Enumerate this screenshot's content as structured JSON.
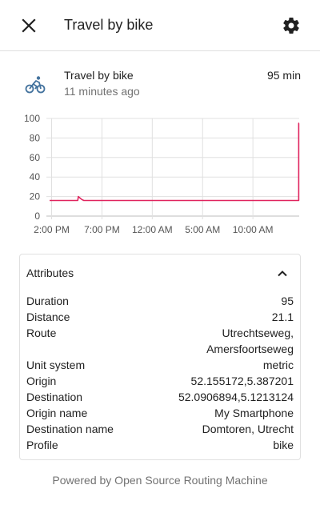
{
  "header": {
    "title": "Travel by bike",
    "close_icon": "close-icon",
    "settings_icon": "gear-icon"
  },
  "entity": {
    "name": "Travel by bike",
    "last_changed": "11 minutes ago",
    "value": "95 min",
    "icon": "bicycle-icon",
    "icon_color": "#44739e"
  },
  "chart_data": {
    "type": "line",
    "title": "",
    "xlabel": "",
    "ylabel": "",
    "ylim": [
      0,
      100
    ],
    "yticks": [
      0,
      20,
      40,
      60,
      80,
      100
    ],
    "xtick_labels": [
      "2:00 PM",
      "7:00 PM",
      "12:00 AM",
      "5:00 AM",
      "10:00 AM"
    ],
    "xtick_hours": [
      14,
      19,
      24,
      29,
      34
    ],
    "xlim_hours": [
      13.8,
      38.6
    ],
    "grid": true,
    "series": [
      {
        "color": "#e0245e",
        "points": [
          [
            13.8,
            16
          ],
          [
            16.6,
            16
          ],
          [
            16.65,
            20
          ],
          [
            17.0,
            17
          ],
          [
            17.2,
            16
          ],
          [
            38.55,
            16
          ],
          [
            38.55,
            95
          ],
          [
            38.6,
            95
          ]
        ]
      }
    ]
  },
  "attributes": {
    "title": "Attributes",
    "toggle_icon": "chevron-up-icon",
    "rows": [
      {
        "name": "Duration",
        "value": "95"
      },
      {
        "name": "Distance",
        "value": "21.1"
      },
      {
        "name": "Route",
        "value": "Utrechtseweg,\nAmersfoortseweg"
      },
      {
        "name": "Unit system",
        "value": "metric"
      },
      {
        "name": "Origin",
        "value": "52.155172,5.387201"
      },
      {
        "name": "Destination",
        "value": "52.0906894,5.1213124"
      },
      {
        "name": "Origin name",
        "value": "My Smartphone"
      },
      {
        "name": "Destination name",
        "value": "Domtoren, Utrecht"
      },
      {
        "name": "Profile",
        "value": "bike"
      }
    ]
  },
  "footer": {
    "text": "Powered by Open Source Routing Machine"
  }
}
